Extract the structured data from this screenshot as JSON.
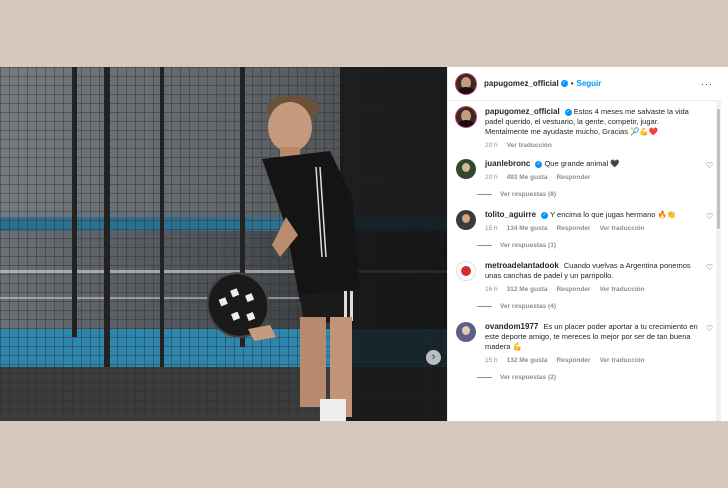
{
  "post": {
    "author": "papugomez_official",
    "follow_label": "Seguir",
    "separator": "•",
    "more_label": "···",
    "caption": "Estos 4 meses me salvaste la vida padel querido, el vestuario, la gente, competir, jugar. Mentalmente me ayudaste mucho, Gracias 🎾💪❤️",
    "caption_time": "20 h",
    "caption_translate": "Ver traducción"
  },
  "media": {
    "next_label": "›"
  },
  "comments": [
    {
      "user": "juanlebronc",
      "verified": true,
      "text": "Que grande animal 🖤",
      "time": "20 h",
      "likes": "493 Me gusta",
      "reply": "Responder",
      "translate": "",
      "replies": "Ver respuestas (8)"
    },
    {
      "user": "tolito_aguirre",
      "verified": true,
      "text": "Y encima lo que jugas hermano 🔥👏",
      "time": "15 h",
      "likes": "134 Me gusta",
      "reply": "Responder",
      "translate": "Ver traducción",
      "replies": "Ver respuestas (1)"
    },
    {
      "user": "metroadelantadook",
      "verified": false,
      "text": "Cuando vuelvas a Argentina ponemos unas canchas de padel y un parripollo.",
      "time": "16 h",
      "likes": "312 Me gusta",
      "reply": "Responder",
      "translate": "Ver traducción",
      "replies": "Ver respuestas (4)"
    },
    {
      "user": "ovandom1977",
      "verified": false,
      "text": "Es un placer poder aportar a tu crecimiento en este deporte amigo, te mereces lo mejor por ser de tan buena madera 💪",
      "time": "15 h",
      "likes": "132 Me gusta",
      "reply": "Responder",
      "translate": "Ver traducción",
      "replies": "Ver respuestas (2)"
    }
  ],
  "icons": {
    "verified": "✓",
    "heart": "♡"
  }
}
